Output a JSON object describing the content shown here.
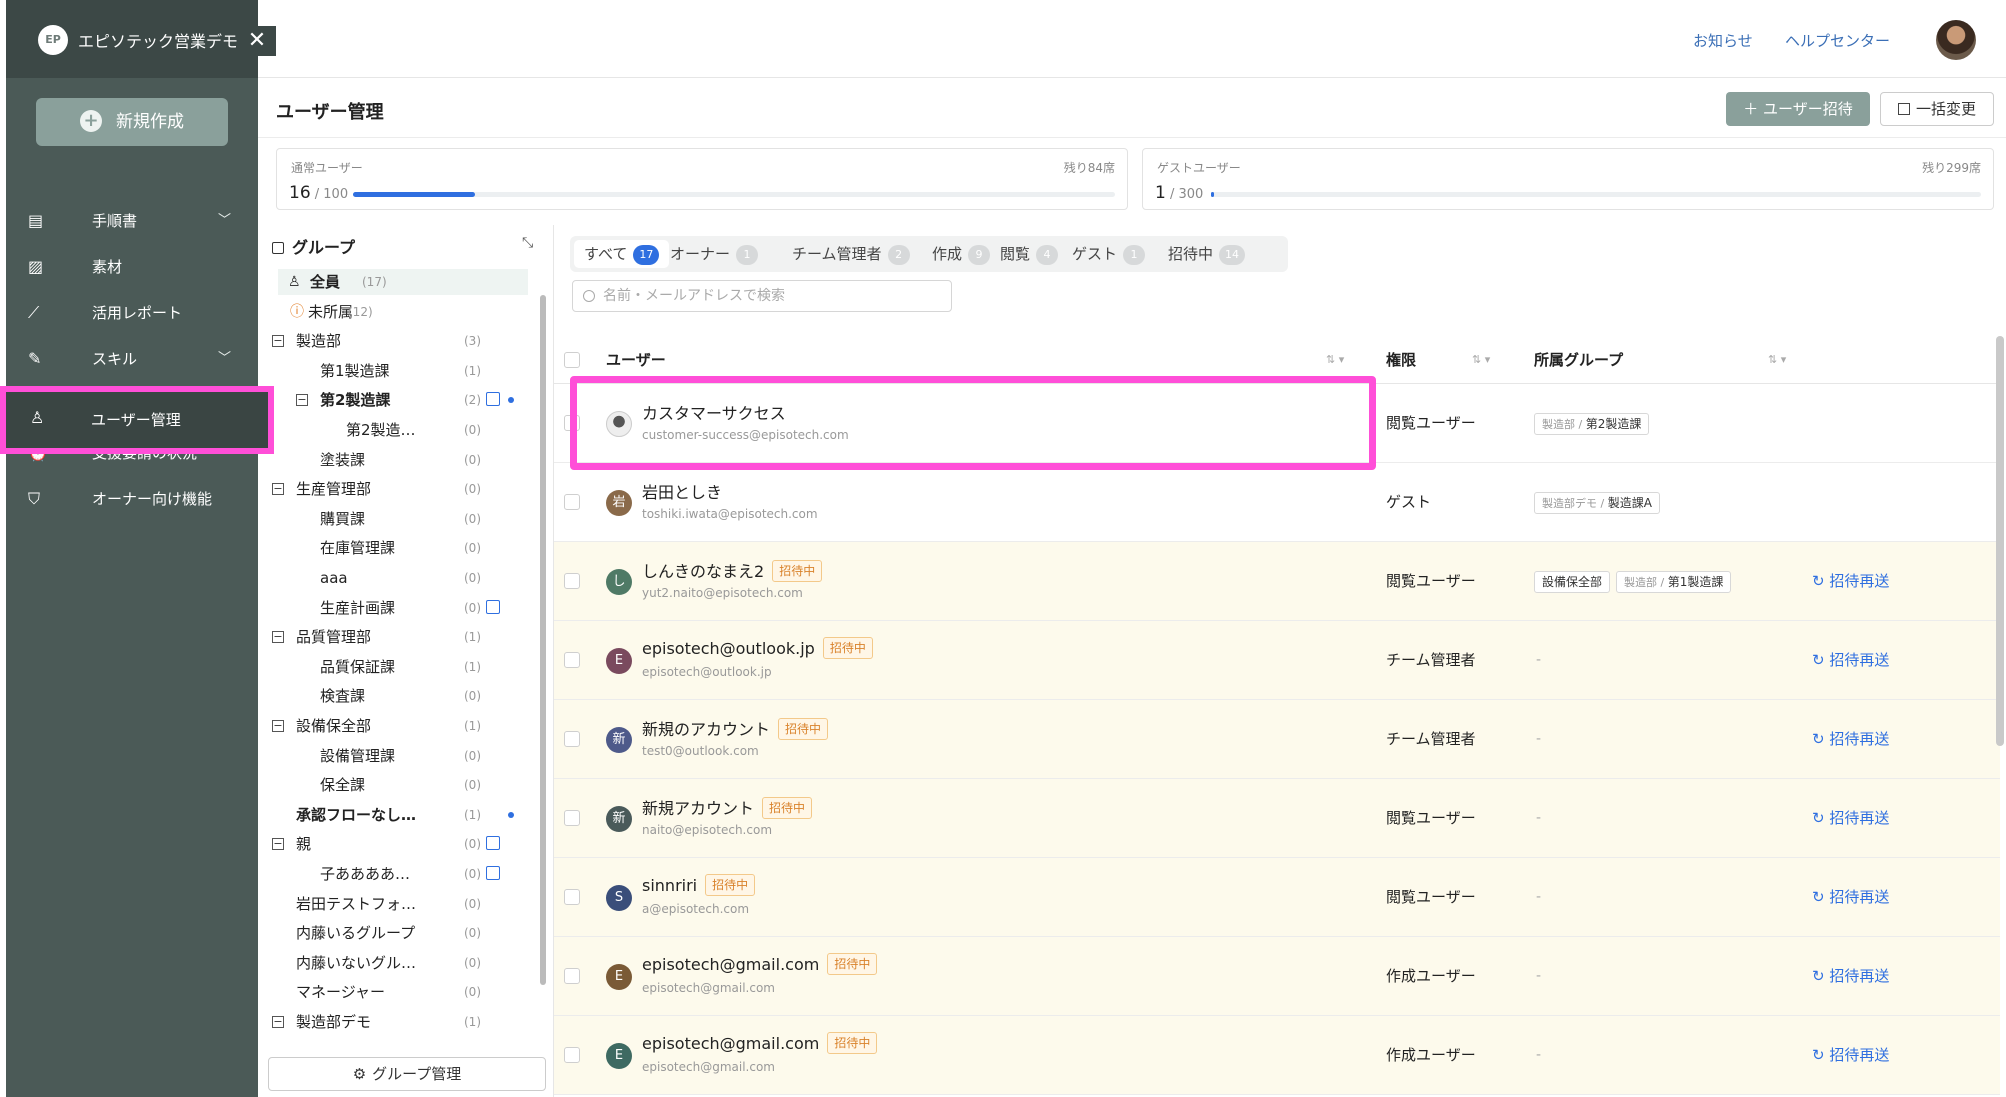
{
  "app": {
    "name": "エピソテック営業デモ",
    "logo_text": "EP",
    "close_glyph": "✕"
  },
  "sidebar": {
    "new_button": "新規作成",
    "items": [
      {
        "label": "手順書",
        "icon": "document-icon",
        "has_chevron": true
      },
      {
        "label": "素材",
        "icon": "image-icon",
        "has_chevron": false
      },
      {
        "label": "活用レポート",
        "icon": "chart-icon",
        "has_chevron": false
      },
      {
        "label": "スキル",
        "icon": "wrench-icon",
        "has_chevron": true
      },
      {
        "label": "ユーザー管理",
        "icon": "user-icon",
        "has_chevron": false,
        "active": true
      },
      {
        "label": "支援要請の状況",
        "icon": "alarm-icon",
        "has_chevron": false
      },
      {
        "label": "オーナー向け機能",
        "icon": "shield-icon",
        "has_chevron": false
      }
    ]
  },
  "header": {
    "notifications": "お知らせ",
    "help": "ヘルプセンター"
  },
  "page": {
    "title": "ユーザー管理",
    "invite_button": "＋ ユーザー招待",
    "bulk_button": "一括変更"
  },
  "seats": {
    "regular": {
      "label": "通常ユーザー",
      "count": "16",
      "total": " / 100",
      "remaining": "残り84席",
      "ratio": 0.16
    },
    "guest": {
      "label": "ゲストユーザー",
      "count": "1",
      "total": " / 300",
      "remaining": "残り299席",
      "ratio": 0.0033
    }
  },
  "groups": {
    "title": "グループ",
    "manage_button": "グループ管理",
    "tree": [
      {
        "label": "全員",
        "count": "(17)",
        "level": 0,
        "special": "all"
      },
      {
        "label": "未所属",
        "count": "(12)",
        "level": 0,
        "special": "none"
      },
      {
        "label": "製造部",
        "count": "(3)",
        "level": 0,
        "box": true
      },
      {
        "label": "第1製造課",
        "count": "(1)",
        "level": 1
      },
      {
        "label": "第2製造課",
        "count": "(2)",
        "level": 1,
        "box": true,
        "bold": true,
        "flag": true,
        "dot": true
      },
      {
        "label": "第2製造…",
        "count": "(0)",
        "level": 2
      },
      {
        "label": "塗装課",
        "count": "(0)",
        "level": 1
      },
      {
        "label": "生産管理部",
        "count": "(0)",
        "level": 0,
        "box": true
      },
      {
        "label": "購買課",
        "count": "(0)",
        "level": 1
      },
      {
        "label": "在庫管理課",
        "count": "(0)",
        "level": 1
      },
      {
        "label": "aaa",
        "count": "(0)",
        "level": 1
      },
      {
        "label": "生産計画課",
        "count": "(0)",
        "level": 1,
        "flag": true
      },
      {
        "label": "品質管理部",
        "count": "(1)",
        "level": 0,
        "box": true
      },
      {
        "label": "品質保証課",
        "count": "(1)",
        "level": 1
      },
      {
        "label": "検査課",
        "count": "(0)",
        "level": 1
      },
      {
        "label": "設備保全部",
        "count": "(1)",
        "level": 0,
        "box": true
      },
      {
        "label": "設備管理課",
        "count": "(0)",
        "level": 1
      },
      {
        "label": "保全課",
        "count": "(0)",
        "level": 1
      },
      {
        "label": "承認フローなし…",
        "count": "(1)",
        "level": 0,
        "bold": true,
        "dot": true
      },
      {
        "label": "親",
        "count": "(0)",
        "level": 0,
        "box": true,
        "flag": true
      },
      {
        "label": "子ああああ…",
        "count": "(0)",
        "level": 1,
        "flag": true
      },
      {
        "label": "岩田テストフォ…",
        "count": "(0)",
        "level": 0
      },
      {
        "label": "内藤いるグループ",
        "count": "(0)",
        "level": 0
      },
      {
        "label": "内藤いないグル…",
        "count": "(0)",
        "level": 0
      },
      {
        "label": "マネージャー",
        "count": "(0)",
        "level": 0
      },
      {
        "label": "製造部デモ",
        "count": "(1)",
        "level": 0,
        "box": true
      }
    ]
  },
  "filters": [
    {
      "label": "すべて",
      "count": "17",
      "active": true
    },
    {
      "label": "オーナー",
      "count": "1"
    },
    {
      "label": "チーム管理者",
      "count": "2"
    },
    {
      "label": "作成",
      "count": "9"
    },
    {
      "label": "閲覧",
      "count": "4"
    },
    {
      "label": "ゲスト",
      "count": "1"
    },
    {
      "label": "招待中",
      "count": "14"
    }
  ],
  "search": {
    "placeholder": "名前・メールアドレスで検索"
  },
  "table": {
    "columns": {
      "user": "ユーザー",
      "role": "権限",
      "groups": "所属グループ"
    },
    "invite_badge": "招待中",
    "resend_label": "招待再送",
    "dash": "-",
    "rows": [
      {
        "name": "カスタマーサクセス",
        "email": "customer-success@episotech.com",
        "avatar": "",
        "avatar_color": "#e8e8e8",
        "invited": false,
        "role": "閲覧ユーザー",
        "groups": [
          {
            "prefix": "製造部 / ",
            "name": "第2製造課"
          }
        ]
      },
      {
        "name": "岩田としき",
        "email": "toshiki.iwata@episotech.com",
        "avatar": "岩",
        "avatar_color": "#8a6a4a",
        "invited": false,
        "role": "ゲスト",
        "groups": [
          {
            "prefix": "製造部デモ / ",
            "name": "製造課A"
          }
        ]
      },
      {
        "name": "しんきのなまえ2",
        "email": "yut2.naito@episotech.com",
        "avatar": "し",
        "avatar_color": "#4f7a66",
        "invited": true,
        "role": "閲覧ユーザー",
        "groups": [
          {
            "prefix": "",
            "name": "設備保全部"
          },
          {
            "prefix": "製造部 / ",
            "name": "第1製造課"
          }
        ]
      },
      {
        "name": "episotech@outlook.jp",
        "email": "episotech@outlook.jp",
        "avatar": "E",
        "avatar_color": "#7a4a5e",
        "invited": true,
        "role": "チーム管理者",
        "groups": []
      },
      {
        "name": "新規のアカウント",
        "email": "test0@outlook.com",
        "avatar": "新",
        "avatar_color": "#4e5a8a",
        "invited": true,
        "role": "チーム管理者",
        "groups": []
      },
      {
        "name": "新規アカウント",
        "email": "naito@episotech.com",
        "avatar": "新",
        "avatar_color": "#4a5a5a",
        "invited": true,
        "role": "閲覧ユーザー",
        "groups": []
      },
      {
        "name": "sinnriri",
        "email": "a@episotech.com",
        "avatar": "S",
        "avatar_color": "#3a4e7a",
        "invited": true,
        "role": "閲覧ユーザー",
        "groups": []
      },
      {
        "name": "episotech@gmail.com",
        "email": "episotech@gmail.com",
        "avatar": "E",
        "avatar_color": "#7a5a36",
        "invited": true,
        "role": "作成ユーザー",
        "groups": []
      },
      {
        "name": "episotech@gmail.com",
        "email": "episotech@gmail.com",
        "avatar": "E",
        "avatar_color": "#3e6a62",
        "invited": true,
        "role": "作成ユーザー",
        "groups": []
      }
    ]
  }
}
